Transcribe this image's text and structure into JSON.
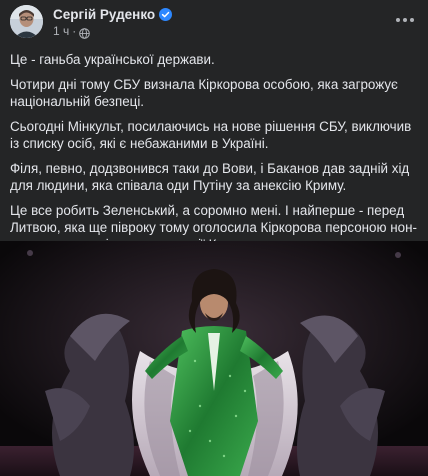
{
  "post": {
    "author": "Сергій Руденко",
    "time": "1 ч",
    "separator": "·",
    "paragraphs": [
      "Це - ганьба української держави.",
      "Чотири дні тому СБУ визнала Кіркорова особою, яка загрожує національній безпеці.",
      "Сьогодні Мінкульт, посилаючись на нове рішення СБУ, виключив із списку осіб, які є небажаними в Україні.",
      "Філя, певно, додзвонився таки до Вови, і Баканов дав задній хід для людини, яка співала оди Путіну за анексію Криму.",
      "Це все робить Зеленський, а соромно мені. І найперше - перед Литвою, яка ще півроку тому оголосила Кіркорова персоною нон-грата саме за підтримку анексії Криму."
    ],
    "icons": {
      "verified": "verified-badge-icon",
      "audience": "globe-icon",
      "more": "more-options-icon"
    }
  },
  "colors": {
    "background": "#242526",
    "text": "#e4e6eb",
    "secondary_text": "#b0b3b8",
    "verified_blue": "#2d88ff",
    "suit_green": "#2e8b3c"
  }
}
